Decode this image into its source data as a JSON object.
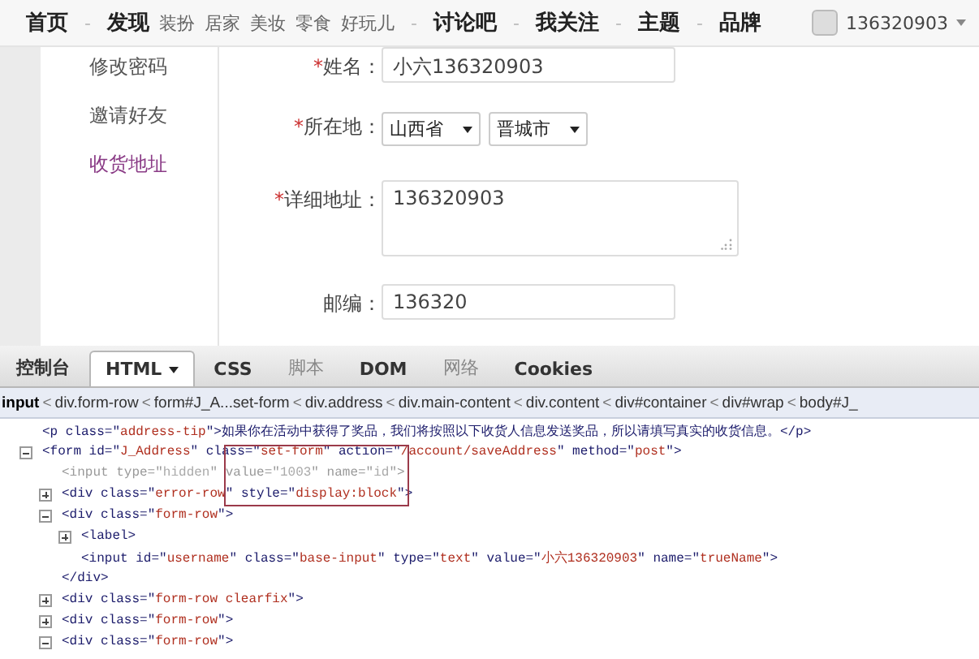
{
  "top_nav": {
    "separator": "-",
    "items": [
      {
        "label": "首页",
        "kind": "main"
      },
      {
        "label": "发现",
        "kind": "main",
        "subitems": [
          "装扮",
          "居家",
          "美妆",
          "零食",
          "好玩儿"
        ]
      },
      {
        "label": "讨论吧",
        "kind": "main"
      },
      {
        "label": "我关注",
        "kind": "main"
      },
      {
        "label": "主题",
        "kind": "main"
      },
      {
        "label": "品牌",
        "kind": "main"
      }
    ],
    "user": {
      "name": "136320903"
    }
  },
  "sidebar": {
    "items": [
      {
        "label": "修改密码",
        "selected": false
      },
      {
        "label": "邀请好友",
        "selected": false
      },
      {
        "label": "收货地址",
        "selected": true
      }
    ]
  },
  "form": {
    "required_mark": "*",
    "rows": [
      {
        "kind": "input",
        "label": "姓名：",
        "required": true,
        "value": "小六136320903"
      },
      {
        "kind": "selects",
        "label": "所在地：",
        "required": true,
        "options": [
          "山西省",
          "晋城市"
        ]
      },
      {
        "kind": "textarea",
        "label": "详细地址：",
        "required": true,
        "value": "136320903"
      },
      {
        "kind": "input",
        "label": "邮编：",
        "required": false,
        "value": "136320"
      },
      {
        "kind": "partial"
      }
    ]
  },
  "devtools": {
    "tabs": [
      {
        "label": "控制台",
        "selected": false,
        "disabled": false
      },
      {
        "label": "HTML",
        "selected": true,
        "disabled": false,
        "dropdown": true
      },
      {
        "label": "CSS",
        "selected": false,
        "disabled": false
      },
      {
        "label": "脚本",
        "selected": false,
        "disabled": true
      },
      {
        "label": "DOM",
        "selected": false,
        "disabled": false
      },
      {
        "label": "网络",
        "selected": false,
        "disabled": true
      },
      {
        "label": "Cookies",
        "selected": false,
        "disabled": false
      }
    ],
    "breadcrumb": {
      "separator": "<",
      "items": [
        "input",
        "div.form-row",
        "form#J_A...set-form",
        "div.address",
        "div.main-content",
        "div.content",
        "div#container",
        "div#wrap",
        "body#J_"
      ]
    },
    "tree": [
      {
        "text": "<p class=\"address-tip\">如果你在活动中获得了奖品，我们将按照以下收货人信息发送奖品，所以请填写真实的收货信息。</p>",
        "dimmed": false
      },
      {
        "text": "<form id=\"J_Address\" class=\"set-form\" action=\"/account/saveAddress\" method=\"post\">",
        "dimmed": false,
        "expanded": true,
        "children": [
          {
            "text": "<input type=\"hidden\" value=\"1003\" name=\"id\">",
            "dimmed": true
          },
          {
            "text": "<div class=\"error-row\" style=\"display:block\">",
            "dimmed": false,
            "expanded": false
          },
          {
            "text": "<div class=\"form-row\">",
            "dimmed": false,
            "expanded": true,
            "close": "</div>",
            "children": [
              {
                "text": "<label>",
                "dimmed": false,
                "expanded": false
              },
              {
                "text": "<input id=\"username\" class=\"base-input\" type=\"text\" value=\"小六136320903\" name=\"trueName\">",
                "dimmed": false
              }
            ]
          },
          {
            "text": "<div class=\"form-row clearfix\">",
            "dimmed": false,
            "expanded": false
          },
          {
            "text": "<div class=\"form-row\">",
            "dimmed": false,
            "expanded": false
          },
          {
            "text": "<div class=\"form-row\">",
            "dimmed": false,
            "expanded": true
          }
        ]
      }
    ]
  }
}
